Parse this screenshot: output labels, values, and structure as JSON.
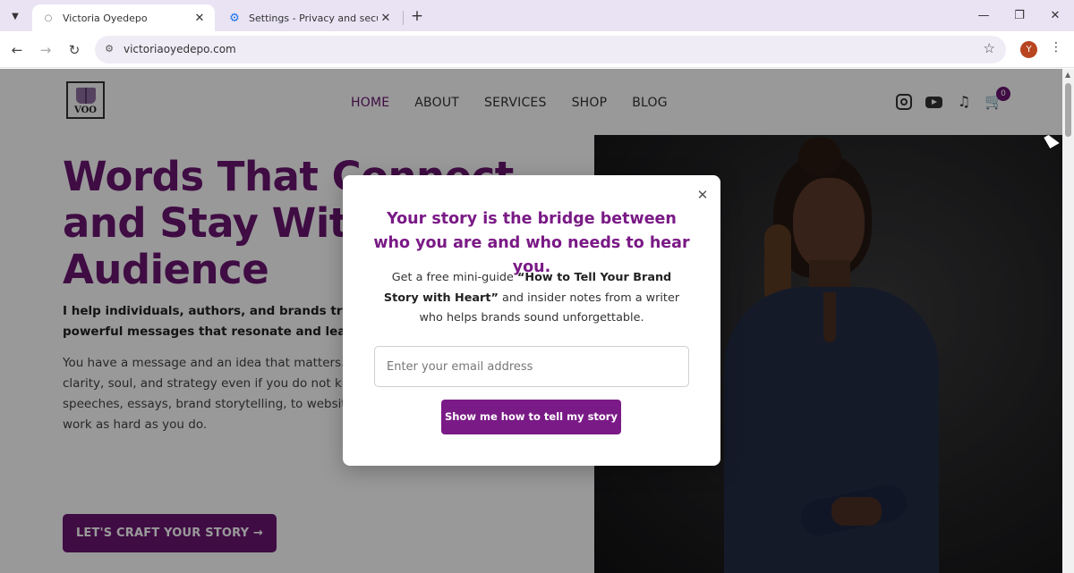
{
  "browser": {
    "tabs": [
      {
        "title": "Victoria Oyedepo",
        "active": true,
        "favicon": "site-favicon"
      },
      {
        "title": "Settings - Privacy and security",
        "active": false,
        "favicon": "gear-icon"
      }
    ],
    "new_tab_icon": "+",
    "url": "victoriaoyedepo.com",
    "profile_initial": "Y",
    "colors": {
      "tabstrip": "#e9e3f4",
      "omnibox": "#f0ecf6",
      "profile": "#b8451f"
    }
  },
  "site": {
    "logo_text": "VOO",
    "nav": [
      {
        "label": "HOME",
        "current": true
      },
      {
        "label": "ABOUT"
      },
      {
        "label": "SERVICES"
      },
      {
        "label": "SHOP"
      },
      {
        "label": "BLOG"
      }
    ],
    "social_icons": [
      "instagram-icon",
      "youtube-icon",
      "tiktok-icon"
    ],
    "cart_count": "0",
    "brand_color": "#6a1571"
  },
  "hero": {
    "title": "Words That Connect\nand Stay With Your\nAudience",
    "subtitle": "I help individuals, authors, and brands transform their ideas into powerful messages that resonate and leave impact.",
    "body": "You have a message and an idea that matters. I help you say it with clarity, soul, and strategy even if you do not know where to begin. From speeches, essays, brand storytelling, to website copy, I make your words work as hard as you do.",
    "cta": "LET'S CRAFT YOUR STORY →"
  },
  "modal": {
    "title": "Your story is the bridge between who you are and who needs to hear you.",
    "text_before": "Get a free mini-guide ",
    "text_bold": "“How to Tell Your Brand Story with Heart”",
    "text_after": " and insider notes from a writer who helps brands sound unforgettable.",
    "email_placeholder": "Enter your email address",
    "button": "Show me how to tell my story",
    "accent": "#7a1a86"
  }
}
